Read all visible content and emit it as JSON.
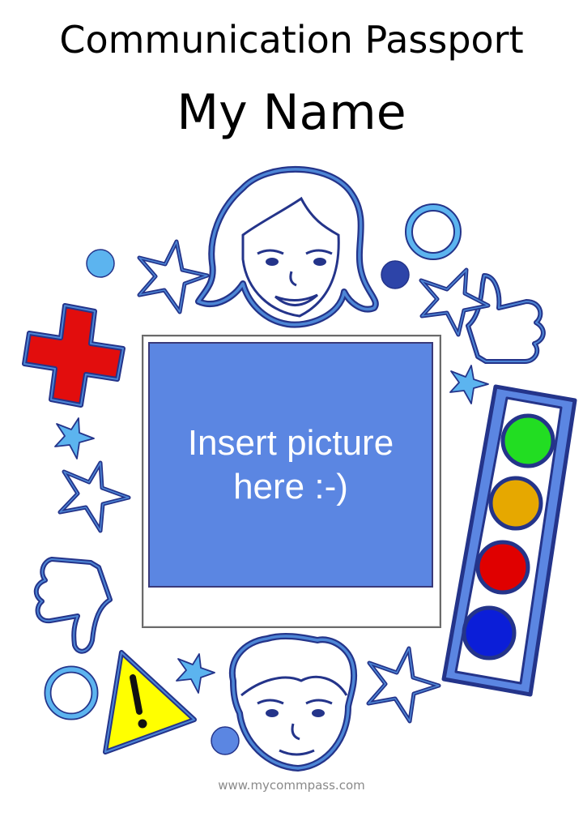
{
  "header": {
    "title": "Communication Passport",
    "name": "My Name"
  },
  "photo": {
    "placeholder": "Insert picture\nhere :-)"
  },
  "footer": {
    "url": "www.mycommpass.com"
  },
  "icons": [
    "girl-face-icon",
    "boy-face-icon",
    "star-icon",
    "medical-cross-icon",
    "thumbs-up-icon",
    "thumbs-down-icon",
    "warning-icon",
    "traffic-light-icon",
    "circle-icon"
  ],
  "colors": {
    "outline": "#24348a",
    "accent_blue": "#4d86d6",
    "light_blue": "#5cb4ef",
    "cross_red": "#e20d0d",
    "warning_yellow": "#ffff00",
    "photo_blue": "#5b86e2",
    "light_green": "#22dd22",
    "light_amber": "#e6a800",
    "light_red": "#e00000",
    "light_blue_dark": "#0b1ed8"
  }
}
